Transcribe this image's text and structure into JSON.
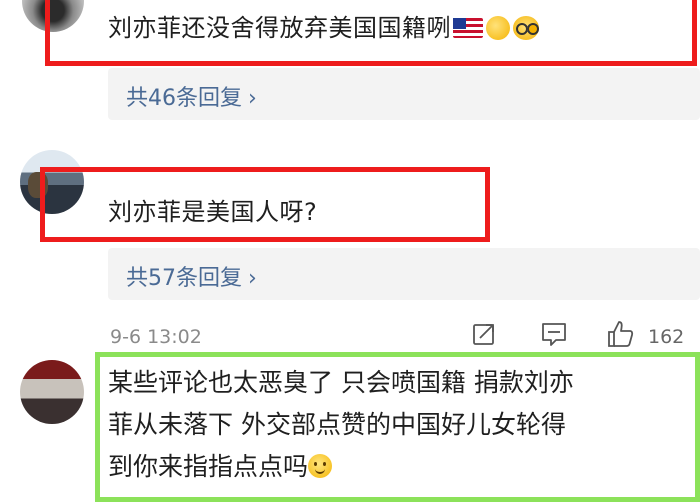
{
  "comments": [
    {
      "text": "刘亦菲还没舍得放弃美国国籍咧",
      "emojis": [
        "us-flag-emoji",
        "thinking-emoji",
        "glasses-emoji"
      ],
      "replies_label": "共46条回复",
      "chevron": "›"
    },
    {
      "text": "刘亦菲是美国人呀?",
      "replies_label": "共57条回复",
      "chevron": "›",
      "timestamp": "9-6 13:02",
      "like_count": "162"
    },
    {
      "lines": [
        "某些评论也太恶臭了 只会喷国籍 捐款刘亦",
        "菲从未落下 外交部点赞的中国好儿女轮得",
        "到你来指指点点吗"
      ],
      "emojis": [
        "smile-emoji"
      ]
    }
  ],
  "colors": {
    "highlight_red": "#ee1c1c",
    "highlight_green": "#8ce25a",
    "link_blue": "#4a6a95",
    "reply_bg": "#f3f3f3"
  }
}
